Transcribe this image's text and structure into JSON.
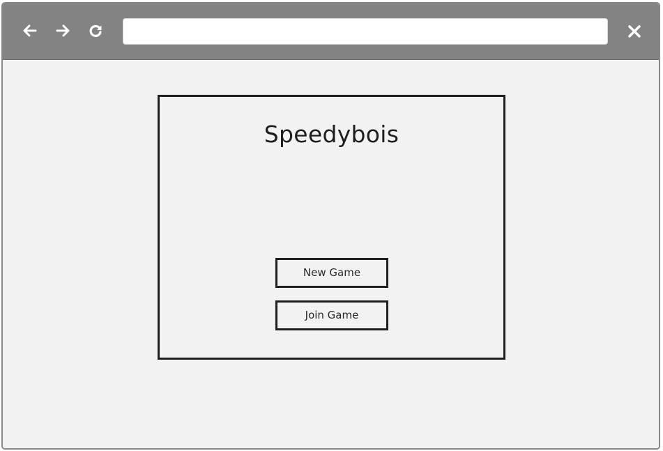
{
  "browser": {
    "address_bar": {
      "value": "",
      "placeholder": ""
    },
    "icons": {
      "back": "back-arrow-icon",
      "forward": "forward-arrow-icon",
      "reload": "reload-icon",
      "close": "close-icon"
    },
    "colors": {
      "toolbar": "#838383",
      "page_background": "#f2f2f2",
      "outline": "#1e1e1e"
    }
  },
  "main": {
    "title": "Speedybois",
    "buttons": {
      "new_game": "New Game",
      "join_game": "Join Game"
    }
  }
}
